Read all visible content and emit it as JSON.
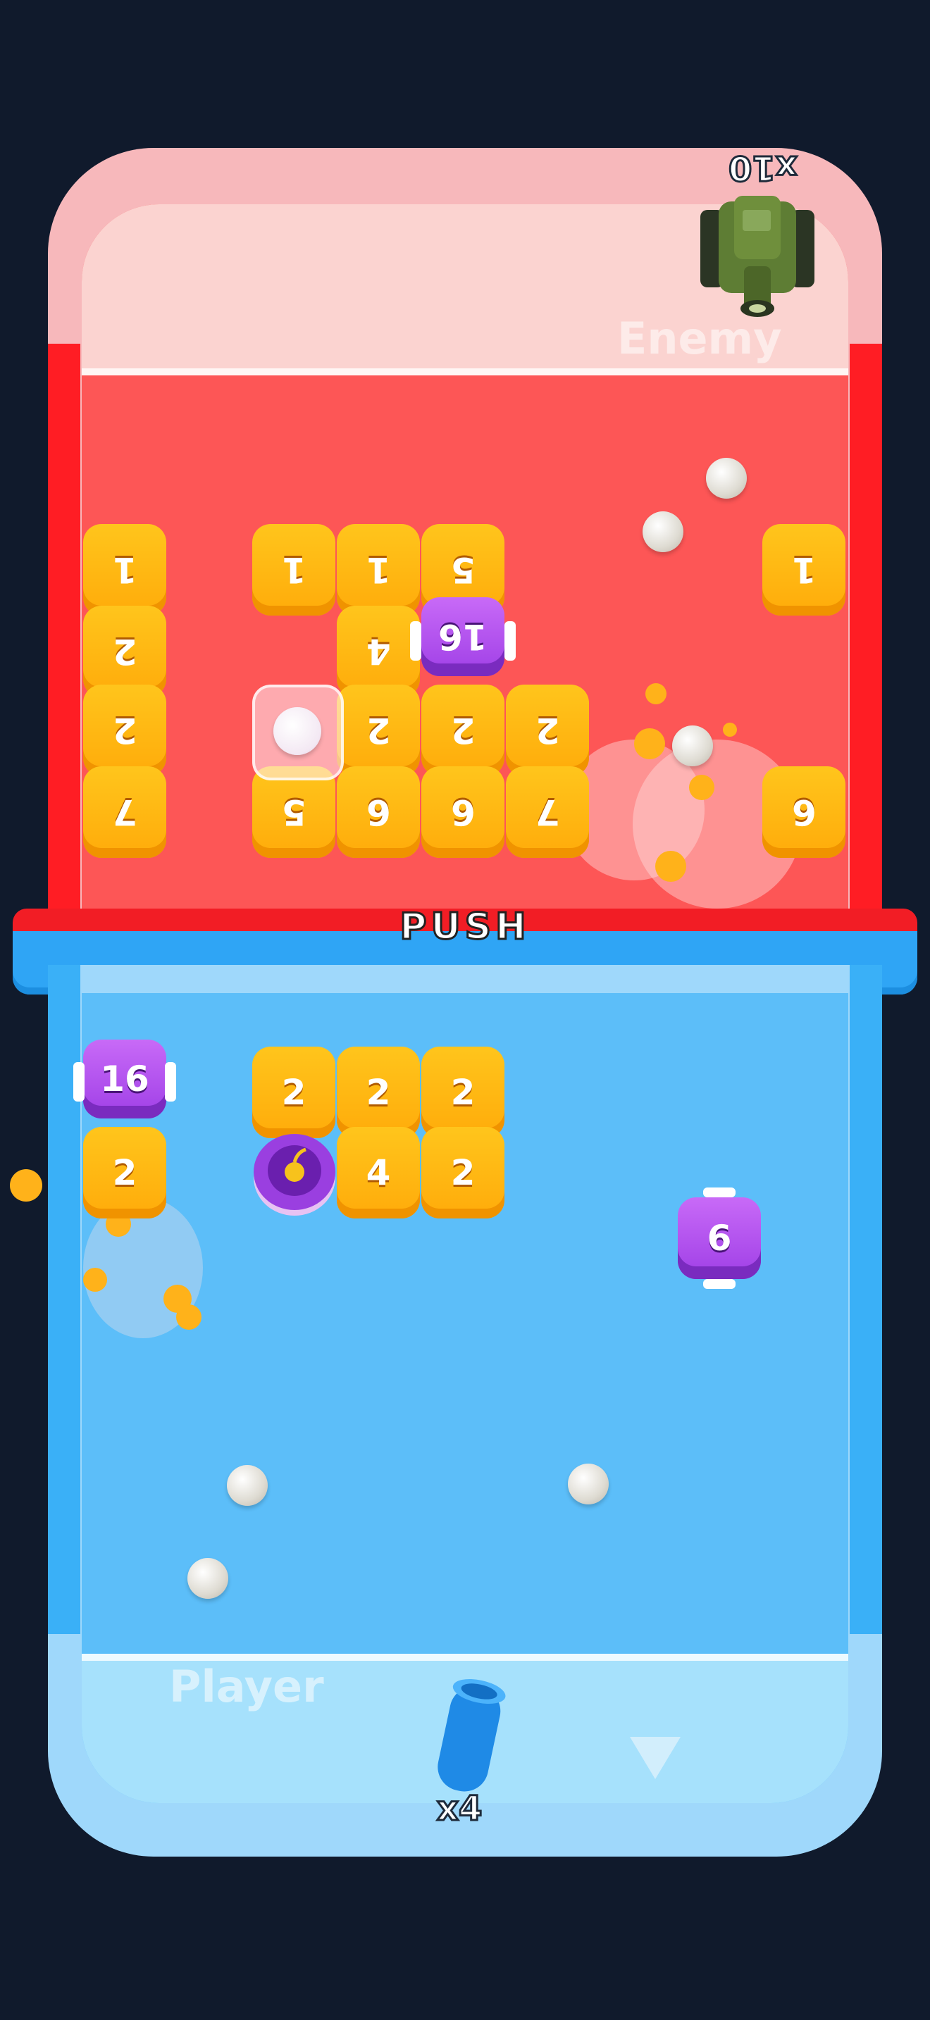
{
  "enemy": {
    "label": "Enemy",
    "multiplier": "x10",
    "blocks": [
      {
        "value": "1"
      },
      {
        "value": "1"
      },
      {
        "value": "1"
      },
      {
        "value": "5"
      },
      {
        "value": "1"
      },
      {
        "value": "2"
      },
      {
        "value": "4"
      },
      {
        "value": "2"
      },
      {
        "value": "2"
      },
      {
        "value": "2"
      },
      {
        "value": "2"
      },
      {
        "value": "7"
      },
      {
        "value": "5"
      },
      {
        "value": "6"
      },
      {
        "value": "6"
      },
      {
        "value": "7"
      },
      {
        "value": "6"
      }
    ],
    "cannon_value": "16"
  },
  "divider": {
    "label": "PUSH"
  },
  "player": {
    "label": "Player",
    "multiplier": "x4",
    "blocks": [
      {
        "value": "2"
      },
      {
        "value": "2"
      },
      {
        "value": "2"
      },
      {
        "value": "2"
      },
      {
        "value": "4"
      },
      {
        "value": "2"
      }
    ],
    "cannon_left_value": "16",
    "cannon_right_value": "6"
  },
  "colors": {
    "enemy_field": "#fd5656",
    "player_field": "#5cbef9",
    "block": "#ffb80f",
    "special_block": "#b056ef"
  },
  "icons": [
    "tank-icon",
    "cannon-icon",
    "bomb-icon",
    "arrow-down-icon",
    "ball-icon"
  ]
}
